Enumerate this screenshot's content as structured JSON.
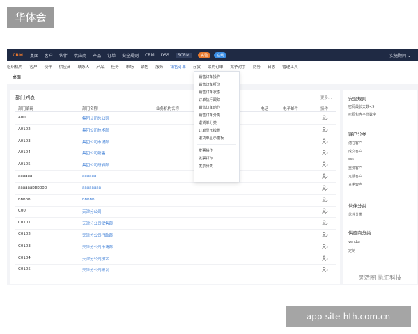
{
  "watermark_top": "华体会",
  "watermark_bottom": "app-site-hth.com.cn",
  "watermark_inline": "灵活圈 执汇科技",
  "topnav": {
    "logo": "CRM",
    "items": [
      "桌面",
      "客户",
      "伙伴",
      "供应商",
      "产品",
      "订单",
      "安全规则",
      "CRM",
      "DSS",
      "SCRM"
    ],
    "badges": [
      "实验",
      "在线"
    ],
    "user": "实施顾问 ⌄"
  },
  "menubar": {
    "items": [
      "组织机构",
      "客户",
      "伙伴",
      "供应商",
      "联系人",
      "产品",
      "任务",
      "市场",
      "销售",
      "服务",
      "销售订单",
      "存货",
      "采购订单",
      "竞争对手",
      "财务",
      "日志",
      "管理工具"
    ],
    "active_index": 10
  },
  "breadcrumb": "桌面",
  "main": {
    "title": "部门列表",
    "more": "更多...",
    "columns": [
      "部门编码",
      "部门名称",
      "业务机构名称",
      "电话",
      "电子邮件",
      "操作"
    ],
    "rows": [
      {
        "code": "A00",
        "name": "集团公司总公司"
      },
      {
        "code": "A0102",
        "name": "集团公司技术部"
      },
      {
        "code": "A0103",
        "name": "集团公司市场部"
      },
      {
        "code": "A0104",
        "name": "集团公司销售"
      },
      {
        "code": "A0105",
        "name": "集团公司研发部"
      },
      {
        "code": "aaaaaa",
        "name": "aaaaaa"
      },
      {
        "code": "aaaaaabbbbbb",
        "name": "aaaaaaaa"
      },
      {
        "code": "bbbbb",
        "name": "bbbbb"
      },
      {
        "code": "C00",
        "name": "天津分公司"
      },
      {
        "code": "C0101",
        "name": "天津分公司销售部"
      },
      {
        "code": "C0102",
        "name": "天津分公司行政部"
      },
      {
        "code": "C0103",
        "name": "天津分公司市场部"
      },
      {
        "code": "C0104",
        "name": "天津分公司技术"
      },
      {
        "code": "C0105",
        "name": "天津分公司研发"
      }
    ]
  },
  "dropdown": {
    "items": [
      "销售订单操作",
      "销售订单打印",
      "销售订单状态",
      "订单执行跟踪",
      "销售订单动作",
      "销售订单分类",
      "退货单分类",
      "订单显示模板",
      "退货单显示模板",
      "发票操作",
      "发票打印",
      "发票分类"
    ]
  },
  "side": {
    "sections": [
      {
        "title": "安全规则",
        "items": [
          "密码最长天数<9",
          "密码包含字符数字"
        ]
      },
      {
        "title": "客户分类",
        "items": [
          "潜在客户",
          "成交客户",
          "sss",
          "重要客户",
          "定期客户",
          "合格客户"
        ]
      },
      {
        "title": "伙伴分类",
        "items": [
          "伙伴分类"
        ]
      },
      {
        "title": "供应商分类",
        "items": [
          "vendor",
          "定制"
        ]
      }
    ]
  },
  "colors": {
    "topnav_bg": "#1f2a44",
    "logo": "#e8772e",
    "link": "#3f7fd6",
    "badge_orange": "#e97b2f",
    "badge_blue": "#3a8ee6"
  }
}
